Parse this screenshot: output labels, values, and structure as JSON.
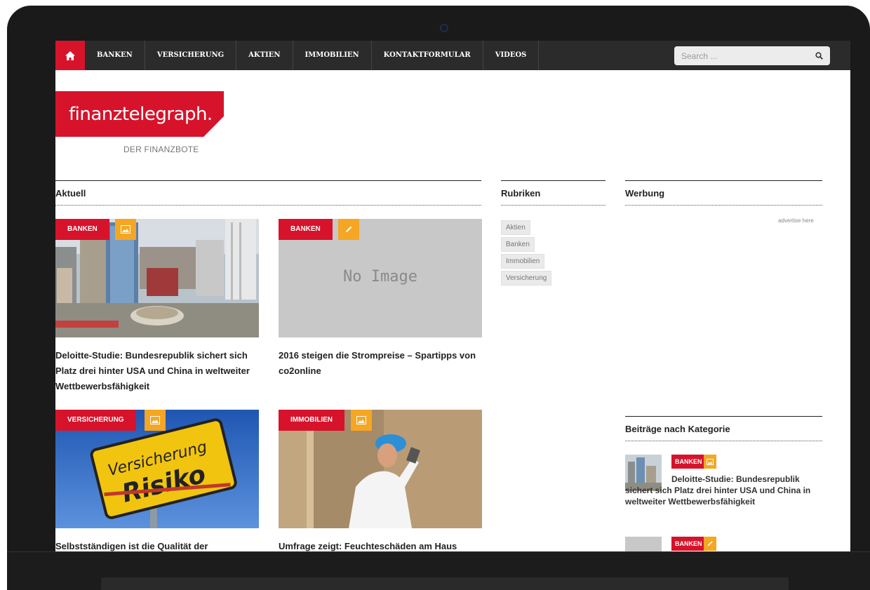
{
  "nav": {
    "items": [
      "BANKEN",
      "VERSICHERUNG",
      "AKTIEN",
      "IMMOBILIEN",
      "KONTAKTFORMULAR",
      "VIDEOS"
    ],
    "search_placeholder": "Search ..."
  },
  "logo": {
    "title": "finanztelegraph.",
    "subtitle": "DER FINANZBOTE"
  },
  "sections": {
    "aktuell": "Aktuell",
    "rubriken": "Rubriken",
    "werbung": "Werbung",
    "beitraege": "Beiträge nach Kategorie"
  },
  "articles": [
    {
      "category": "BANKEN",
      "title": "Deloitte-Studie: Bundesrepublik sichert sich Platz drei hinter USA und China in weltweiter Wettbewerbsfähigkeit",
      "icon": "image-icon"
    },
    {
      "category": "BANKEN",
      "title": "2016 steigen die Strompreise – Spartipps von co2online",
      "icon": "pencil-icon",
      "placeholder": "No Image"
    },
    {
      "category": "VERSICHERUNG",
      "title": "Selbstständigen ist die Qualität der",
      "icon": "image-icon",
      "sign_top": "Versicherung",
      "sign_bottom": "Risiko"
    },
    {
      "category": "IMMOBILIEN",
      "title": "Umfrage zeigt: Feuchteschäden am Haus",
      "icon": "image-icon"
    }
  ],
  "rubriken": [
    "Aktien",
    "Banken",
    "Immobilien",
    "Versicherung"
  ],
  "werbung": {
    "text": "advertise here"
  },
  "sidebar_posts": [
    {
      "category": "BANKEN",
      "title": "Deloitte-Studie: Bundesrepublik sichert sich Platz drei hinter USA und China in weltweiter Wettbewerbsfähigkeit",
      "icon": "image-icon"
    },
    {
      "category": "BANKEN",
      "title": "",
      "icon": "pencil-icon"
    }
  ],
  "colors": {
    "accent": "#d6132b",
    "badge_icon": "#f5a623",
    "nav_bg": "#2b2b2b"
  }
}
